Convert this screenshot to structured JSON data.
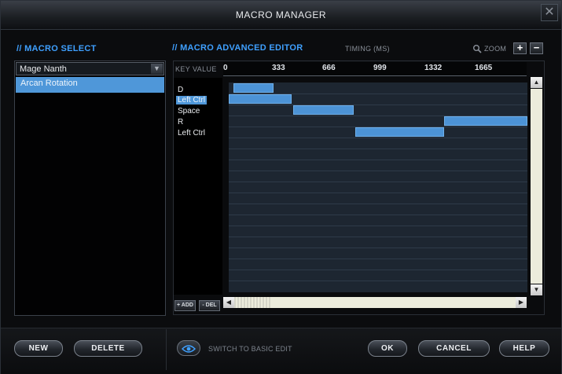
{
  "window": {
    "title": "MACRO MANAGER",
    "close_glyph": "✕"
  },
  "macro_select": {
    "heading": "// MACRO SELECT",
    "dropdown_value": "Mage Nanth",
    "items": [
      {
        "label": "Arcan Rotation",
        "selected": true
      }
    ]
  },
  "editor": {
    "heading": "// MACRO ADVANCED EDITOR",
    "timing_label": "TIMING (MS)",
    "zoom_label": "ZOOM",
    "zoom_in_glyph": "+",
    "zoom_out_glyph": "−",
    "key_value_header": "KEY VALUE",
    "ruler_ticks": [
      "0",
      "333",
      "666",
      "999",
      "1332",
      "1665"
    ],
    "keys": [
      "D",
      "Left Ctrl",
      "Space",
      "R",
      "Left Ctrl"
    ],
    "selected_key_index": 1,
    "add_label": "+ ADD",
    "del_label": "- DEL"
  },
  "footer": {
    "new_label": "NEW",
    "delete_label": "DELETE",
    "switch_label": "SWITCH TO BASIC EDIT",
    "ok_label": "OK",
    "cancel_label": "CANCEL",
    "help_label": "HELP"
  },
  "colors": {
    "accent": "#3fa0ff",
    "selection": "#4f97d9",
    "timeline_block": "#4c93d6",
    "grid_bg": "#1d2631"
  }
}
